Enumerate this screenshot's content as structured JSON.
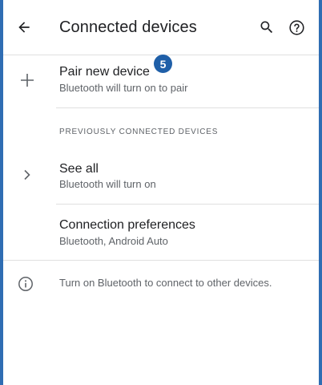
{
  "toolbar": {
    "title": "Connected devices",
    "back_icon": "arrow-left-icon",
    "search_icon": "search-icon",
    "help_icon": "help-circle-icon"
  },
  "pair_new_device": {
    "title": "Pair new device",
    "summary": "Bluetooth will turn on to pair",
    "icon": "plus-icon",
    "badge": "5"
  },
  "previously_connected": {
    "header": "PREVIOUSLY CONNECTED DEVICES",
    "see_all": {
      "title": "See all",
      "summary": "Bluetooth will turn on",
      "icon": "chevron-right-icon"
    }
  },
  "connection_preferences": {
    "title": "Connection preferences",
    "summary": "Bluetooth, Android Auto"
  },
  "footer": {
    "icon": "info-icon",
    "text": "Turn on Bluetooth to connect to other devices."
  },
  "colors": {
    "accent_border": "#2f6db3",
    "badge": "#1f5fa8",
    "primary_text": "#202124",
    "secondary_text": "#5f6368",
    "divider": "#e0e0e0"
  }
}
